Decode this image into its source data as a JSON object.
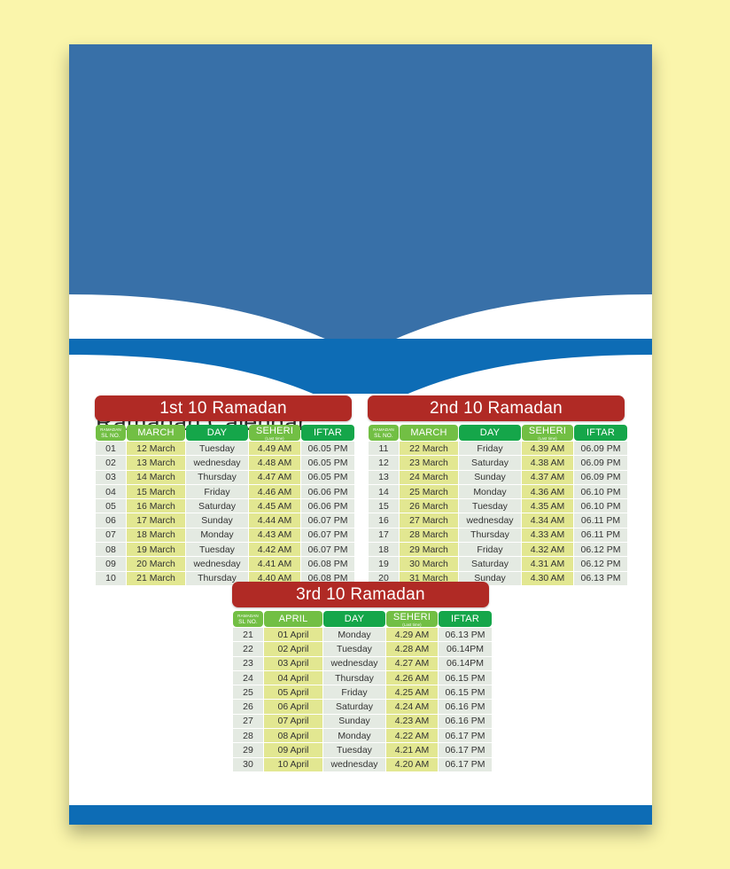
{
  "document": {
    "title": "Ramadan Calendar",
    "background_color": "#faf5ab",
    "hero_color": "#3870a8",
    "band_color": "#0d6cb5",
    "banner_color": "#b02a25"
  },
  "columns": {
    "sl_line1": "RAMADAN",
    "sl_line2": "SL NO.",
    "month_march": "MARCH",
    "month_april": "APRIL",
    "day": "DAY",
    "seheri": "SEHERI",
    "seheri_sub": "(Last time)",
    "iftar": "IFTAR"
  },
  "tables": [
    {
      "banner": "1st 10 Ramadan",
      "month_header": "MARCH",
      "rows": [
        {
          "sl": "01",
          "date": "12 March",
          "day": "Tuesday",
          "seheri": "4.49 AM",
          "iftar": "06.05 PM"
        },
        {
          "sl": "02",
          "date": "13 March",
          "day": "wednesday",
          "seheri": "4.48 AM",
          "iftar": "06.05 PM"
        },
        {
          "sl": "03",
          "date": "14 March",
          "day": "Thursday",
          "seheri": "4.47 AM",
          "iftar": "06.05 PM"
        },
        {
          "sl": "04",
          "date": "15 March",
          "day": "Friday",
          "seheri": "4.46 AM",
          "iftar": "06.06 PM"
        },
        {
          "sl": "05",
          "date": "16 March",
          "day": "Saturday",
          "seheri": "4.45 AM",
          "iftar": "06.06 PM"
        },
        {
          "sl": "06",
          "date": "17 March",
          "day": "Sunday",
          "seheri": "4.44 AM",
          "iftar": "06.07 PM"
        },
        {
          "sl": "07",
          "date": "18 March",
          "day": "Monday",
          "seheri": "4.43 AM",
          "iftar": "06.07 PM"
        },
        {
          "sl": "08",
          "date": "19 March",
          "day": "Tuesday",
          "seheri": "4.42 AM",
          "iftar": "06.07 PM"
        },
        {
          "sl": "09",
          "date": "20 March",
          "day": "wednesday",
          "seheri": "4.41 AM",
          "iftar": "06.08 PM"
        },
        {
          "sl": "10",
          "date": "21 March",
          "day": "Thursday",
          "seheri": "4.40 AM",
          "iftar": "06.08 PM"
        }
      ]
    },
    {
      "banner": "2nd 10 Ramadan",
      "month_header": "MARCH",
      "rows": [
        {
          "sl": "11",
          "date": "22 March",
          "day": "Friday",
          "seheri": "4.39 AM",
          "iftar": "06.09 PM"
        },
        {
          "sl": "12",
          "date": "23 March",
          "day": "Saturday",
          "seheri": "4.38 AM",
          "iftar": "06.09 PM"
        },
        {
          "sl": "13",
          "date": "24 March",
          "day": "Sunday",
          "seheri": "4.37 AM",
          "iftar": "06.09 PM"
        },
        {
          "sl": "14",
          "date": "25 March",
          "day": "Monday",
          "seheri": "4.36 AM",
          "iftar": "06.10 PM"
        },
        {
          "sl": "15",
          "date": "26 March",
          "day": "Tuesday",
          "seheri": "4.35 AM",
          "iftar": "06.10 PM"
        },
        {
          "sl": "16",
          "date": "27 March",
          "day": "wednesday",
          "seheri": "4.34 AM",
          "iftar": "06.11 PM"
        },
        {
          "sl": "17",
          "date": "28 March",
          "day": "Thursday",
          "seheri": "4.33 AM",
          "iftar": "06.11 PM"
        },
        {
          "sl": "18",
          "date": "29 March",
          "day": "Friday",
          "seheri": "4.32 AM",
          "iftar": "06.12 PM"
        },
        {
          "sl": "19",
          "date": "30 March",
          "day": "Saturday",
          "seheri": "4.31 AM",
          "iftar": "06.12 PM"
        },
        {
          "sl": "20",
          "date": "31 March",
          "day": "Sunday",
          "seheri": "4.30 AM",
          "iftar": "06.13 PM"
        }
      ]
    },
    {
      "banner": "3rd 10 Ramadan",
      "month_header": "APRIL",
      "rows": [
        {
          "sl": "21",
          "date": "01 April",
          "day": "Monday",
          "seheri": "4.29 AM",
          "iftar": "06.13 PM"
        },
        {
          "sl": "22",
          "date": "02 April",
          "day": "Tuesday",
          "seheri": "4.28 AM",
          "iftar": "06.14PM"
        },
        {
          "sl": "23",
          "date": "03 April",
          "day": "wednesday",
          "seheri": "4.27 AM",
          "iftar": "06.14PM"
        },
        {
          "sl": "24",
          "date": "04 April",
          "day": "Thursday",
          "seheri": "4.26 AM",
          "iftar": "06.15 PM"
        },
        {
          "sl": "25",
          "date": "05 April",
          "day": "Friday",
          "seheri": "4.25 AM",
          "iftar": "06.15 PM"
        },
        {
          "sl": "26",
          "date": "06 April",
          "day": "Saturday",
          "seheri": "4.24 AM",
          "iftar": "06.16 PM"
        },
        {
          "sl": "27",
          "date": "07 April",
          "day": "Sunday",
          "seheri": "4.23 AM",
          "iftar": "06.16 PM"
        },
        {
          "sl": "28",
          "date": "08 April",
          "day": "Monday",
          "seheri": "4.22 AM",
          "iftar": "06.17 PM"
        },
        {
          "sl": "29",
          "date": "09 April",
          "day": "Tuesday",
          "seheri": "4.21 AM",
          "iftar": "06.17 PM"
        },
        {
          "sl": "30",
          "date": "10 April",
          "day": "wednesday",
          "seheri": "4.20 AM",
          "iftar": "06.17 PM"
        }
      ]
    }
  ]
}
